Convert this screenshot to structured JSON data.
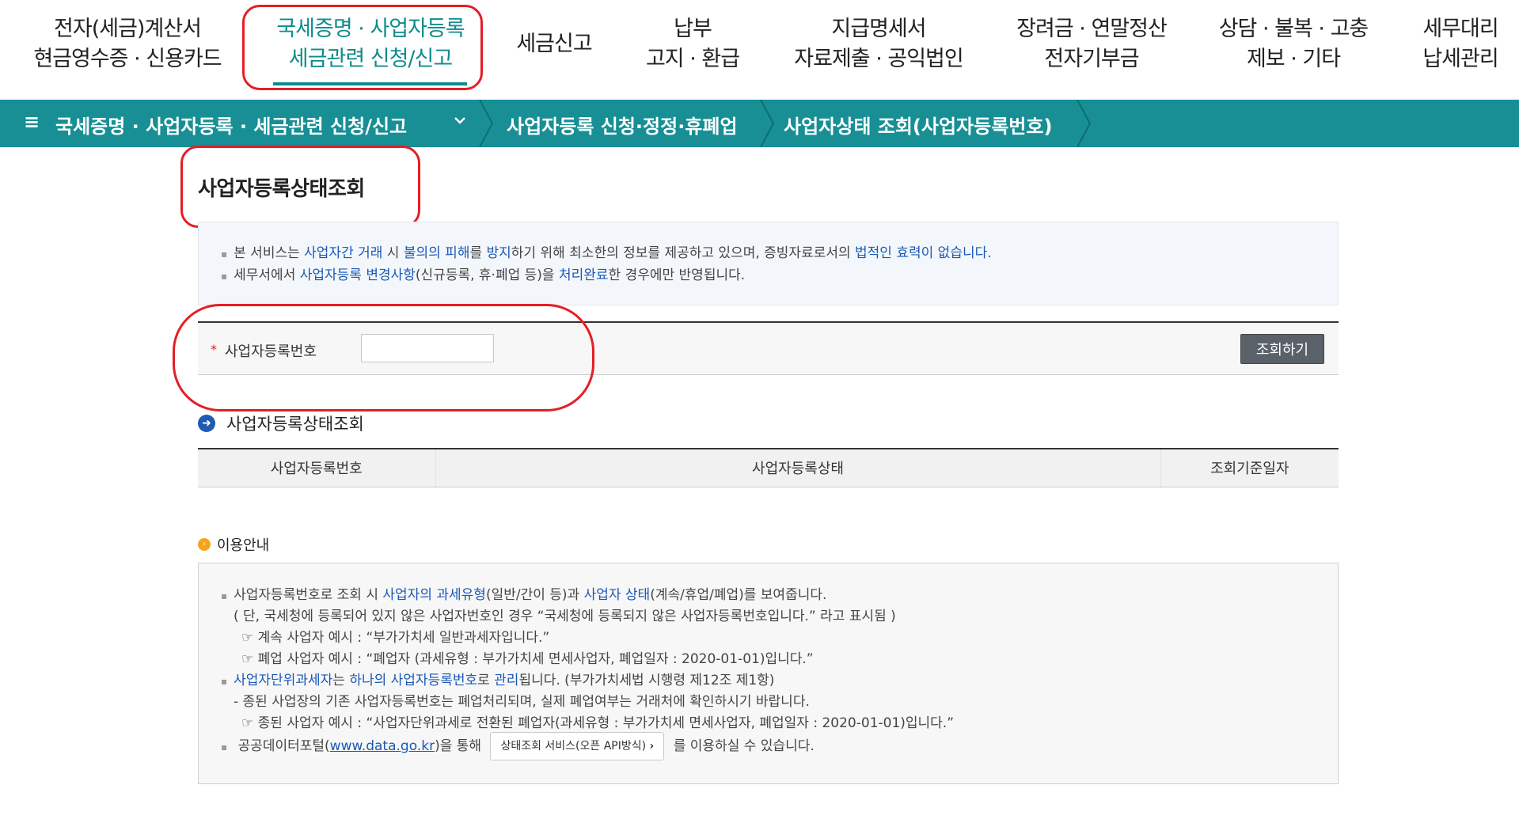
{
  "topnav": {
    "items": [
      {
        "line1": "전자(세금)계산서",
        "line2": "현금영수증 · 신용카드"
      },
      {
        "line1": "국세증명 · 사업자등록",
        "line2": "세금관련 신청/신고"
      },
      {
        "line1": "세금신고",
        "line2": ""
      },
      {
        "line1": "납부",
        "line2": "고지 · 환급"
      },
      {
        "line1": "지급명세서",
        "line2": "자료제출 · 공익법인"
      },
      {
        "line1": "장려금 · 연말정산",
        "line2": "전자기부금"
      },
      {
        "line1": "상담 · 불복 · 고충",
        "line2": "제보 · 기타"
      },
      {
        "line1": "세무대리",
        "line2": "납세관리"
      }
    ]
  },
  "breadcrumb": {
    "menu_icon": "≡",
    "level1": "국세증명 · 사업자등록 · 세금관련 신청/신고",
    "level2": "사업자등록 신청·정정·휴폐업",
    "level3": "사업자상태 조회(사업자등록번호)"
  },
  "page_title": "사업자등록상태조회",
  "notice": {
    "line1": {
      "a": "본 서비스는 ",
      "b": "사업자간 거래",
      "c": " 시 ",
      "d": "불의의 피해",
      "e": "를 ",
      "f": "방지",
      "g": "하기 위해 최소한의 정보를 제공하고 있으며, 증빙자료로서의 ",
      "h": "법적인 효력이 없습니다."
    },
    "line2": {
      "a": "세무서에서 ",
      "b": "사업자등록 변경사항",
      "c": "(신규등록, 휴·폐업 등)을 ",
      "d": "처리완료",
      "e": "한 경우에만 반영됩니다."
    }
  },
  "form": {
    "required_mark": "*",
    "label": "사업자등록번호",
    "input_value": "",
    "search_button": "조회하기"
  },
  "result": {
    "section_title": "사업자등록상태조회",
    "columns": [
      "사업자등록번호",
      "사업자등록상태",
      "조회기준일자"
    ]
  },
  "guide": {
    "title": "이용안내",
    "l1": {
      "a": "사업자등록번호로 조회 시 ",
      "b": "사업자의 과세유형",
      "c": "(일반/간이 등)과 ",
      "d": "사업자 상태",
      "e": "(계속/휴업/폐업)를 보여줍니다."
    },
    "l2": "( 단, 국세청에 등록되어 있지 않은 사업자번호인 경우 “국세청에 등록되지 않은 사업자등록번호입니다.” 라고 표시됨 )",
    "l3": "☞ 계속 사업자 예시 : “부가가치세 일반과세자입니다.”",
    "l4": "☞ 폐업 사업자 예시 : “폐업자 (과세유형 : 부가가치세 면세사업자, 폐업일자 : 2020-01-01)입니다.”",
    "l5": {
      "a": "사업자단위과세자",
      "b": "는 ",
      "c": "하나의 사업자등록번호",
      "d": "로 ",
      "e": "관리",
      "f": "됩니다. (부가가치세법 시행령 제12조 제1항)"
    },
    "l6": "- 종된 사업장의 기존 사업자등록번호는 폐업처리되며, 실제 폐업여부는 거래처에 확인하시기 바랍니다.",
    "l7": "☞ 종된 사업자 예시 : “사업자단위과세로 전환된 폐업자(과세유형 : 부가가치세 면세사업자, 폐업일자 : 2020-01-01)입니다.”",
    "l8": {
      "a": "공공데이터포털(",
      "link": "www.data.go.kr",
      "b": ")을 통해",
      "button": "상태조회 서비스(오픈 API방식)",
      "button_icon": "›",
      "c": "를 이용하실 수 있습니다."
    }
  },
  "colors": {
    "accent": "#178f94",
    "highlight": "#e41e26",
    "link": "#1b58b7"
  }
}
